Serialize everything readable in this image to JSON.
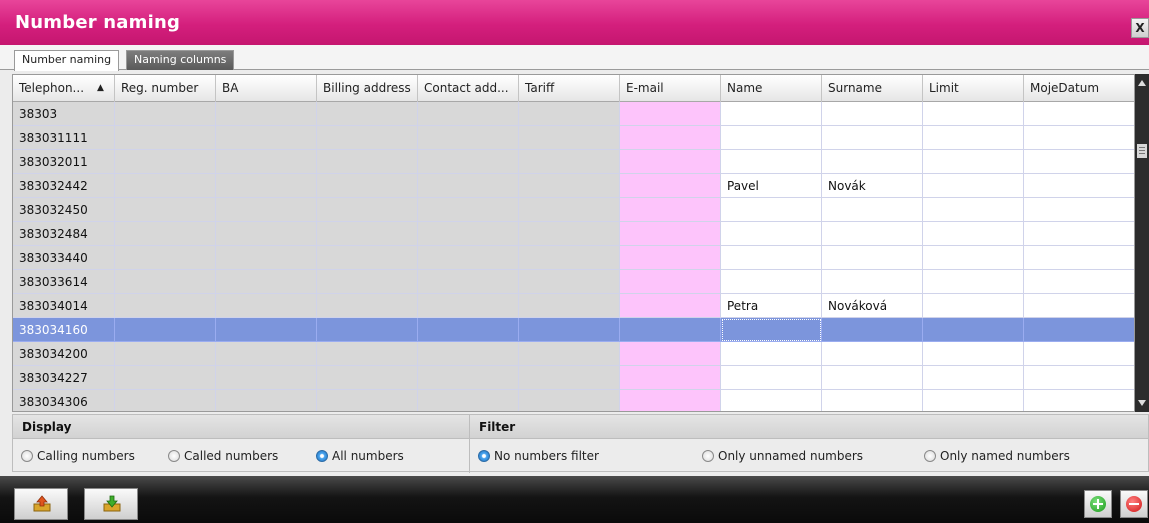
{
  "window": {
    "title": "Number naming",
    "close_label": "X"
  },
  "tabs": [
    {
      "label": "Number naming",
      "active": true
    },
    {
      "label": "Naming columns",
      "active": false
    }
  ],
  "grid": {
    "columns": [
      {
        "label": "Telephon...",
        "sorted": "ascending",
        "sort_glyph": "▲"
      },
      {
        "label": "Reg. number"
      },
      {
        "label": "BA"
      },
      {
        "label": "Billing address"
      },
      {
        "label": "Contact add..."
      },
      {
        "label": "Tariff"
      },
      {
        "label": "E-mail"
      },
      {
        "label": "Name"
      },
      {
        "label": "Surname"
      },
      {
        "label": "Limit"
      },
      {
        "label": "MojeDatum"
      }
    ],
    "rows": [
      {
        "phone": "38303",
        "name": "",
        "surname": ""
      },
      {
        "phone": "383031111",
        "name": "",
        "surname": ""
      },
      {
        "phone": "383032011",
        "name": "",
        "surname": ""
      },
      {
        "phone": "383032442",
        "name": "Pavel",
        "surname": "Novák"
      },
      {
        "phone": "383032450",
        "name": "",
        "surname": ""
      },
      {
        "phone": "383032484",
        "name": "",
        "surname": ""
      },
      {
        "phone": "383033440",
        "name": "",
        "surname": ""
      },
      {
        "phone": "383033614",
        "name": "",
        "surname": ""
      },
      {
        "phone": "383034014",
        "name": "Petra",
        "surname": "Nováková"
      },
      {
        "phone": "383034160",
        "name": "",
        "surname": "",
        "selected": true
      },
      {
        "phone": "383034200",
        "name": "",
        "surname": ""
      },
      {
        "phone": "383034227",
        "name": "",
        "surname": ""
      },
      {
        "phone": "383034306",
        "name": "",
        "surname": ""
      }
    ]
  },
  "display": {
    "heading": "Display",
    "options": [
      {
        "label": "Calling numbers",
        "checked": false
      },
      {
        "label": "Called numbers",
        "checked": false
      },
      {
        "label": "All numbers",
        "checked": true
      }
    ]
  },
  "filter": {
    "heading": "Filter",
    "options": [
      {
        "label": "No numbers filter",
        "checked": true
      },
      {
        "label": "Only unnamed numbers",
        "checked": false
      },
      {
        "label": "Only named numbers",
        "checked": false
      }
    ]
  },
  "toolbar": {
    "export_icon": "export-icon",
    "import_icon": "import-icon",
    "add_icon": "add-icon",
    "remove_icon": "remove-icon"
  },
  "colors": {
    "title_bar": "#d41f7d",
    "readonly_cell": "#d8d8d8",
    "email_cell": "#fdc4fb",
    "selected_row": "#7c95dc"
  }
}
